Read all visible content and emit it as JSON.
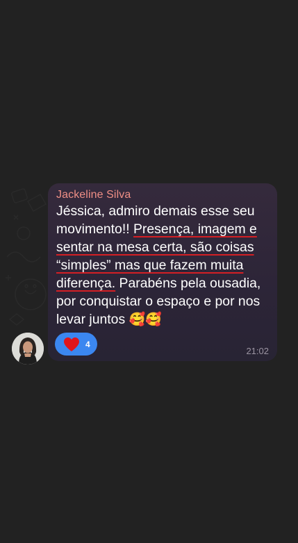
{
  "chat": {
    "message": {
      "sender": "Jackeline Silva",
      "text_parts": [
        "Jéssica, admiro demais esse seu movimento!! ",
        "Presença, imagem e sentar na mesa certa, são coisas “simples” mas que fazem muita diferença.",
        " Parabéns pela ousadia, por conquistar o espaço e por nos levar juntos ",
        "🥰🥰"
      ],
      "reaction": {
        "icon": "heart-icon",
        "count": "4"
      },
      "time": "21:02"
    },
    "colors": {
      "background": "#222222",
      "bubble": "#2d2538",
      "sender_name": "#ef8f86",
      "reaction_pill": "#3b87f0",
      "highlight_underline": "#d51f24"
    }
  }
}
